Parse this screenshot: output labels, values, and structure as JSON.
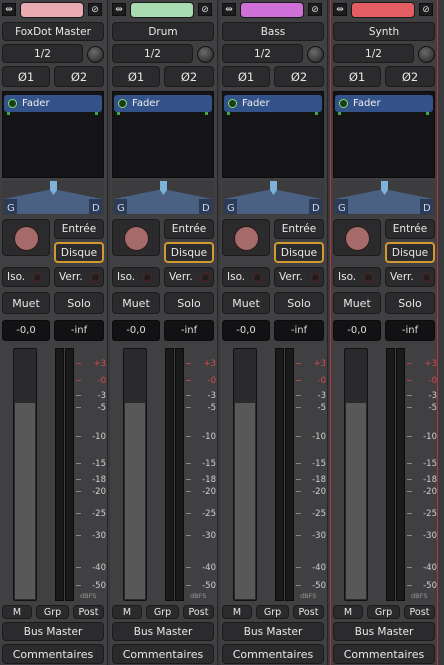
{
  "strips": [
    {
      "name": "FoxDot Master",
      "color": "#e9aab2",
      "route": "1/2",
      "phase": [
        "Ø1",
        "Ø2"
      ],
      "plugin": "Fader",
      "pan_left": "G",
      "pan_right": "D",
      "input_label": "Entrée",
      "disk_label": "Disque",
      "isolate_label": "Iso.",
      "lock_label": "Verr.",
      "mute_label": "Muet",
      "solo_label": "Solo",
      "gain_value": "-0,0",
      "peak_value": "-inf",
      "meter_points": [
        "M",
        "Grp",
        "Post"
      ],
      "output": "Bus Master",
      "comments": "Commentaires",
      "selected": false,
      "bypass_icon": "link-icon",
      "hide_icon": "eye-hidden-icon"
    },
    {
      "name": "Drum",
      "color": "#a9ddb1",
      "route": "1/2",
      "phase": [
        "Ø1",
        "Ø2"
      ],
      "plugin": "Fader",
      "pan_left": "G",
      "pan_right": "D",
      "input_label": "Entrée",
      "disk_label": "Disque",
      "isolate_label": "Iso.",
      "lock_label": "Verr.",
      "mute_label": "Muet",
      "solo_label": "Solo",
      "gain_value": "-0,0",
      "peak_value": "-inf",
      "meter_points": [
        "M",
        "Grp",
        "Post"
      ],
      "output": "Bus Master",
      "comments": "Commentaires",
      "selected": false,
      "bypass_icon": "link-icon",
      "hide_icon": "eye-hidden-icon"
    },
    {
      "name": "Bass",
      "color": "#cf6fd8",
      "route": "1/2",
      "phase": [
        "Ø1",
        "Ø2"
      ],
      "plugin": "Fader",
      "pan_left": "G",
      "pan_right": "D",
      "input_label": "Entrée",
      "disk_label": "Disque",
      "isolate_label": "Iso.",
      "lock_label": "Verr.",
      "mute_label": "Muet",
      "solo_label": "Solo",
      "gain_value": "-0,0",
      "peak_value": "-inf",
      "meter_points": [
        "M",
        "Grp",
        "Post"
      ],
      "output": "Bus Master",
      "comments": "Commentaires",
      "selected": false,
      "bypass_icon": "link-icon",
      "hide_icon": "eye-hidden-icon"
    },
    {
      "name": "Synth",
      "color": "#e25e63",
      "route": "1/2",
      "phase": [
        "Ø1",
        "Ø2"
      ],
      "plugin": "Fader",
      "pan_left": "G",
      "pan_right": "D",
      "input_label": "Entrée",
      "disk_label": "Disque",
      "isolate_label": "Iso.",
      "lock_label": "Verr.",
      "mute_label": "Muet",
      "solo_label": "Solo",
      "gain_value": "-0,0",
      "peak_value": "-inf",
      "meter_points": [
        "M",
        "Grp",
        "Post"
      ],
      "output": "Bus Master",
      "comments": "Commentaires",
      "selected": true,
      "bypass_icon": "link-icon",
      "hide_icon": "eye-hidden-icon"
    }
  ],
  "meter_scale": [
    {
      "label": "+3",
      "red": true
    },
    {
      "label": "-0",
      "red": true
    },
    {
      "label": "-3",
      "red": false
    },
    {
      "label": "-5",
      "red": false
    },
    {
      "label": "-10",
      "red": false
    },
    {
      "label": "-15",
      "red": false
    },
    {
      "label": "-18",
      "red": false
    },
    {
      "label": "-20",
      "red": false
    },
    {
      "label": "-25",
      "red": false
    },
    {
      "label": "-30",
      "red": false
    },
    {
      "label": "-40",
      "red": false
    },
    {
      "label": "-50",
      "red": false
    }
  ],
  "meter_unit": "dBFS",
  "fader_level": 0.78,
  "pan_position": 0.5
}
